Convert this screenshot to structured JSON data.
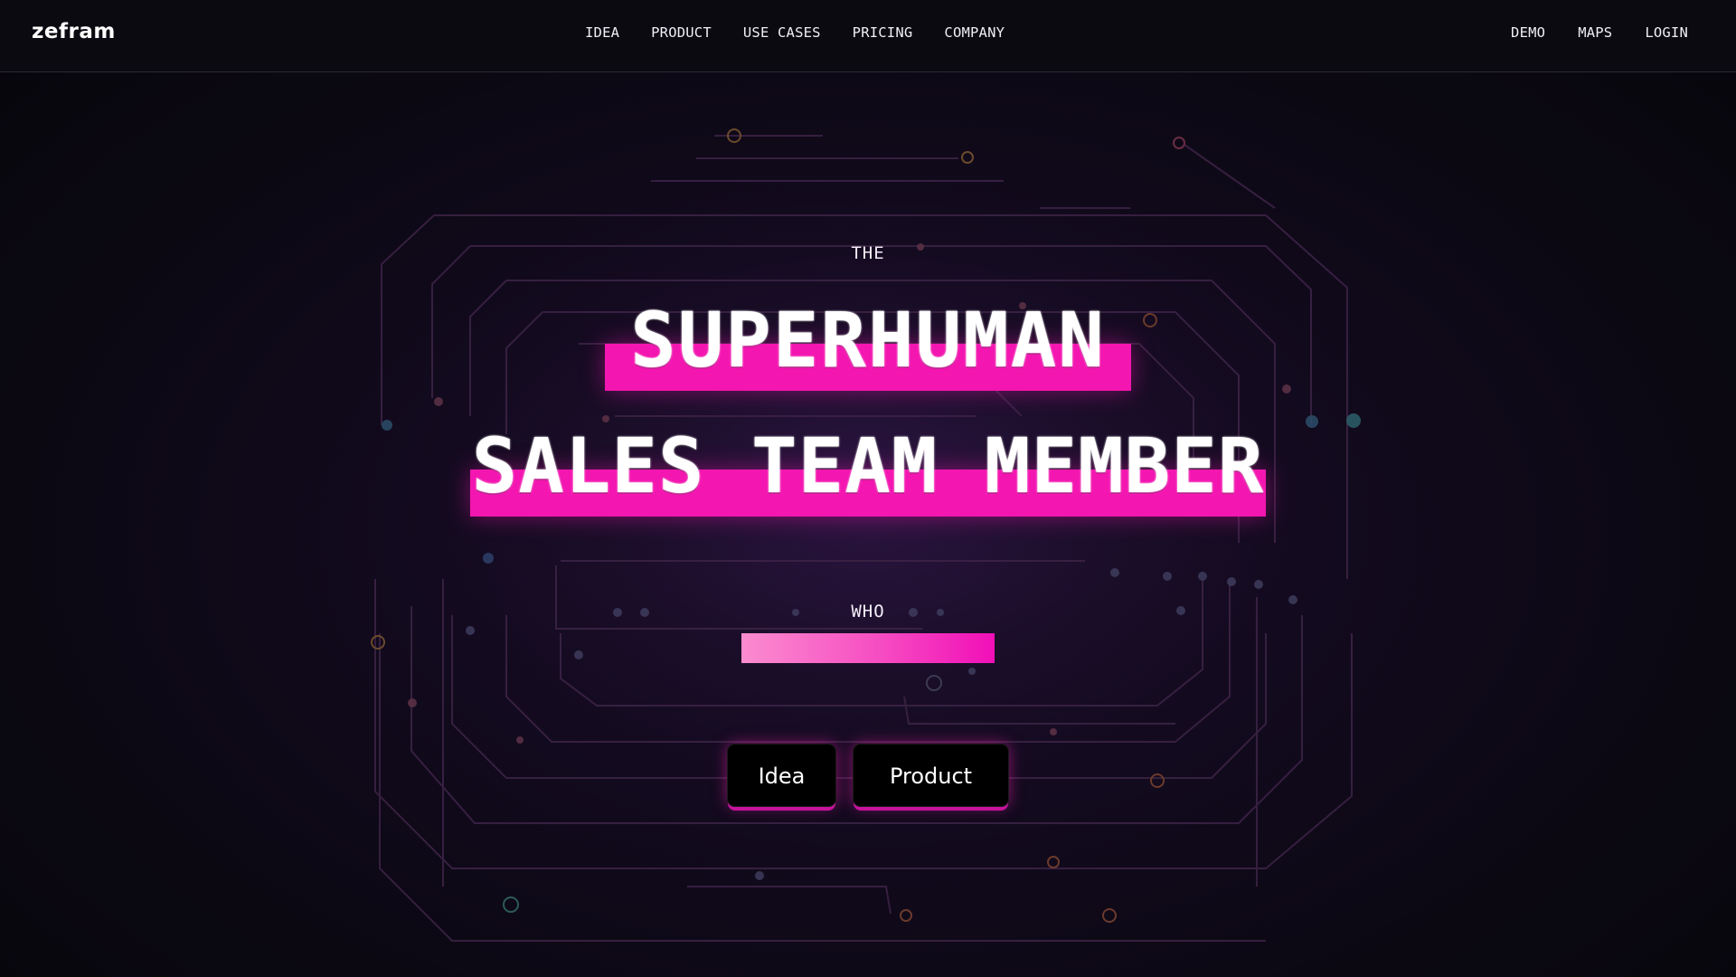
{
  "header": {
    "logo": "zefram",
    "nav_center": [
      {
        "label": "IDEA"
      },
      {
        "label": "PRODUCT"
      },
      {
        "label": "USE CASES"
      },
      {
        "label": "PRICING"
      },
      {
        "label": "COMPANY"
      }
    ],
    "nav_right": [
      {
        "label": "DEMO"
      },
      {
        "label": "MAPS"
      },
      {
        "label": "LOGIN"
      }
    ]
  },
  "hero": {
    "eyebrow_top": "THE",
    "headline_line1": "SUPERHUMAN",
    "headline_line2": "SALES TEAM MEMBER",
    "eyebrow_bottom": "WHO",
    "buttons": {
      "idea": "Idea",
      "product": "Product"
    }
  },
  "colors": {
    "accent": "#f316b0",
    "accent_light": "#fb8ccf",
    "background": "#0b0812",
    "button_bg": "#000000"
  }
}
